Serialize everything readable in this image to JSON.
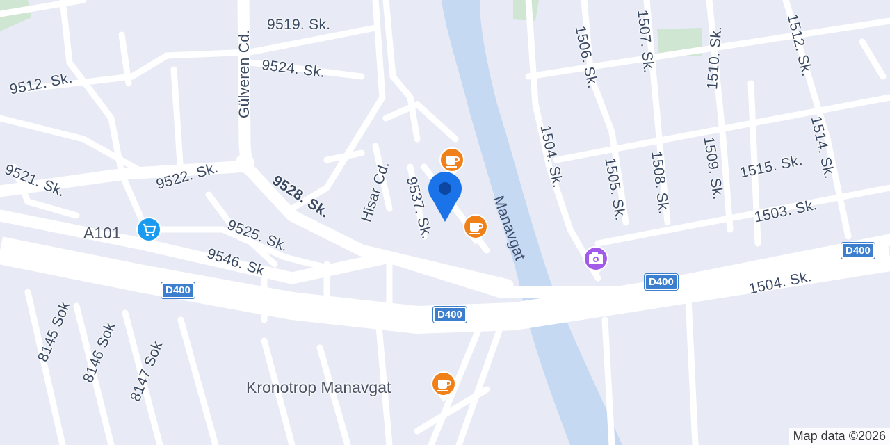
{
  "map": {
    "streets": [
      {
        "id": "s9519",
        "text": "9519. Sk."
      },
      {
        "id": "s9524",
        "text": "9524. Sk."
      },
      {
        "id": "s9512",
        "text": "9512. Sk."
      },
      {
        "id": "gulveren",
        "text": "Gülveren Cd."
      },
      {
        "id": "s9521",
        "text": "9521. Sk."
      },
      {
        "id": "s9522",
        "text": "9522. Sk."
      },
      {
        "id": "s9528",
        "text": "9528. Sk."
      },
      {
        "id": "hisar",
        "text": "Hisar Cd."
      },
      {
        "id": "s9537",
        "text": "9537. Sk."
      },
      {
        "id": "s9525",
        "text": "9525. Sk."
      },
      {
        "id": "s9546",
        "text": "9546. Sk"
      },
      {
        "id": "s8145",
        "text": "8145 Sok"
      },
      {
        "id": "s8146",
        "text": "8146 Sok"
      },
      {
        "id": "s8147",
        "text": "8147 Sok"
      },
      {
        "id": "s1506",
        "text": "1506. Sk."
      },
      {
        "id": "s1507",
        "text": "1507. Sk."
      },
      {
        "id": "s1510",
        "text": "1510. Sk."
      },
      {
        "id": "s1512",
        "text": "1512. Sk."
      },
      {
        "id": "s1504a",
        "text": "1504. Sk."
      },
      {
        "id": "s1505",
        "text": "1505. Sk."
      },
      {
        "id": "s1508",
        "text": "1508. Sk."
      },
      {
        "id": "s1509",
        "text": "1509. Sk."
      },
      {
        "id": "s1515",
        "text": "1515. Sk."
      },
      {
        "id": "s1514",
        "text": "1514. Sk."
      },
      {
        "id": "s1503",
        "text": "1503. Sk."
      },
      {
        "id": "s1504b",
        "text": "1504. Sk."
      }
    ],
    "river_label": "Manavgat",
    "route_shields": [
      "D400",
      "D400",
      "D400",
      "D400"
    ],
    "places": [
      {
        "id": "a101",
        "label": "A101",
        "icon": "shopping-cart-icon",
        "color": "#1a9bf0"
      },
      {
        "id": "kronotrop",
        "label": "Kronotrop Manavgat",
        "icon": "coffee-cup-icon",
        "color": "#f0811a"
      },
      {
        "id": "cafe1",
        "label": "",
        "icon": "coffee-cup-icon",
        "color": "#f0811a"
      },
      {
        "id": "cafe2",
        "label": "",
        "icon": "coffee-cup-icon",
        "color": "#f0811a"
      },
      {
        "id": "photo",
        "label": "",
        "icon": "camera-icon",
        "color": "#a15be8"
      }
    ],
    "current_location": {
      "icon": "location-pin-icon",
      "color": "#1a73e8"
    },
    "credit": "Map data ©2026"
  }
}
